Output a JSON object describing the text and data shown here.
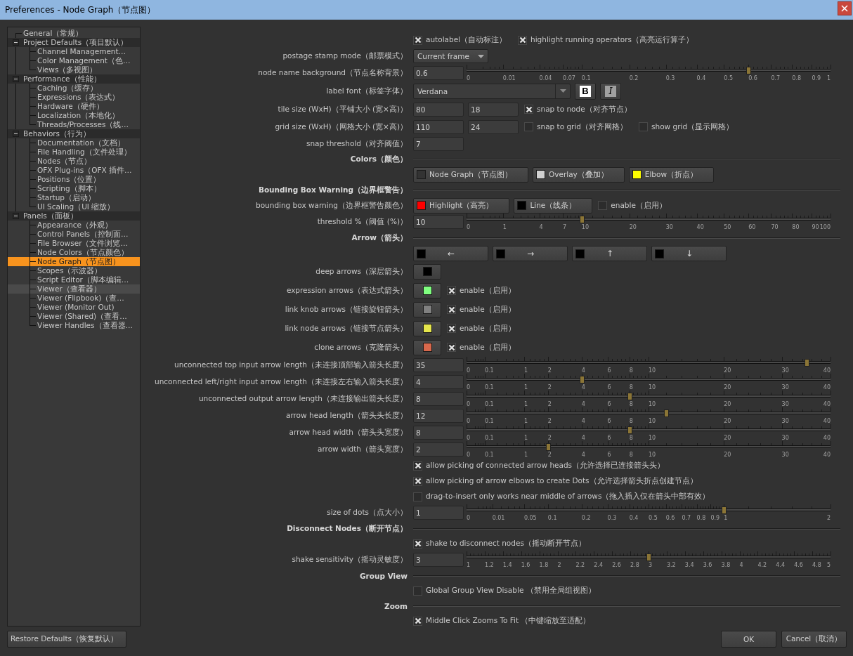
{
  "window": {
    "title": "Preferences - Node Graph（节点图）"
  },
  "sidebar": {
    "items": [
      {
        "label": "General（常规）",
        "selected": false,
        "hovered": false
      },
      {
        "label": "Project Defaults（项目默认）",
        "expanded": true,
        "selected": false,
        "hovered": false,
        "children": [
          {
            "label": "Channel Management…",
            "selected": false,
            "hovered": false
          },
          {
            "label": "Color Management（色…",
            "selected": false,
            "hovered": false
          },
          {
            "label": "Views（多视图）",
            "selected": false,
            "hovered": false
          }
        ]
      },
      {
        "label": "Performance（性能）",
        "expanded": true,
        "selected": false,
        "hovered": false,
        "children": [
          {
            "label": "Caching（缓存）",
            "selected": false,
            "hovered": false
          },
          {
            "label": "Expressions（表达式）",
            "selected": false,
            "hovered": false
          },
          {
            "label": "Hardware（硬件）",
            "selected": false,
            "hovered": false
          },
          {
            "label": "Localization（本地化）",
            "selected": false,
            "hovered": false
          },
          {
            "label": "Threads/Processes（线…",
            "selected": false,
            "hovered": false
          }
        ]
      },
      {
        "label": "Behaviors（行为）",
        "expanded": true,
        "selected": false,
        "hovered": false,
        "children": [
          {
            "label": "Documentation（文档）",
            "selected": false,
            "hovered": false
          },
          {
            "label": "File Handling（文件处理）",
            "selected": false,
            "hovered": false
          },
          {
            "label": "Nodes（节点）",
            "selected": false,
            "hovered": false
          },
          {
            "label": "OFX Plug-ins（OFX 插件…",
            "selected": false,
            "hovered": false
          },
          {
            "label": "Positions（位置）",
            "selected": false,
            "hovered": false
          },
          {
            "label": "Scripting（脚本）",
            "selected": false,
            "hovered": false
          },
          {
            "label": "Startup（启动）",
            "selected": false,
            "hovered": false
          },
          {
            "label": "UI Scaling（UI 缩放）",
            "selected": false,
            "hovered": false
          }
        ]
      },
      {
        "label": "Panels（面板）",
        "expanded": true,
        "selected": false,
        "hovered": false,
        "children": [
          {
            "label": "Appearance（外观）",
            "selected": false,
            "hovered": false
          },
          {
            "label": "Control Panels（控制面…",
            "selected": false,
            "hovered": false
          },
          {
            "label": "File Browser（文件浏览…",
            "selected": false,
            "hovered": false
          },
          {
            "label": "Node Colors（节点颜色）",
            "selected": false,
            "hovered": false
          },
          {
            "label": "Node Graph（节点图）",
            "selected": true,
            "hovered": false
          },
          {
            "label": "Scopes（示波器）",
            "selected": false,
            "hovered": false
          },
          {
            "label": "Script Editor（脚本编辑…",
            "selected": false,
            "hovered": false
          },
          {
            "label": "Viewer（查看器）",
            "selected": false,
            "hovered": true
          },
          {
            "label": "Viewer (Flipbook)（查…",
            "selected": false,
            "hovered": false
          },
          {
            "label": "Viewer (Monitor Out)",
            "selected": false,
            "hovered": false
          },
          {
            "label": "Viewer (Shared)（查看…",
            "selected": false,
            "hovered": false
          },
          {
            "label": "Viewer Handles（查看器…",
            "selected": false,
            "hovered": false
          }
        ]
      }
    ]
  },
  "rows": [
    {
      "kind": "checks",
      "checks": [
        {
          "label": "autolabel（自动标注）",
          "checked": true
        },
        {
          "label": "highlight running operators（高亮运行算子）",
          "checked": true
        }
      ]
    },
    {
      "kind": "dropdown",
      "label": "postage stamp mode（邮票模式）",
      "value": "Current frame"
    },
    {
      "kind": "slider",
      "label": "node name background（节点名称背景）",
      "value": "0.6",
      "level": 0.775,
      "ticks": [
        "0",
        "0.01",
        "0.04",
        "0.07",
        "0.1",
        "0.2",
        "0.3",
        "0.4",
        "0.5",
        "0.6",
        "0.7",
        "0.8",
        "0.9",
        "1"
      ]
    },
    {
      "kind": "font",
      "label": "label font（标签字体）",
      "value": "Verdana",
      "bold_label": "B",
      "italic_label": "I"
    },
    {
      "kind": "pair",
      "label": "tile size (WxH)（平铺大小 (宽×高)）",
      "values": [
        "80",
        "18"
      ],
      "checks": [
        {
          "label": "snap to node（对齐节点）",
          "checked": true
        }
      ]
    },
    {
      "kind": "pair",
      "label": "grid size (WxH)（网格大小 (宽×高)）",
      "values": [
        "110",
        "24"
      ],
      "checks": [
        {
          "label": "snap to grid（对齐网格）",
          "checked": false
        },
        {
          "label": "show grid（显示网格）",
          "checked": false
        }
      ]
    },
    {
      "kind": "input",
      "label": "snap threshold（对齐阈值）",
      "value": "7"
    },
    {
      "kind": "section",
      "label": "Colors（颜色）"
    },
    {
      "kind": "colors",
      "buttons": [
        {
          "label": "Node Graph（节点图）",
          "color": "#333333"
        },
        {
          "label": "Overlay（叠加）",
          "color": "#d0d0d0"
        },
        {
          "label": "Elbow（折点）",
          "color": "#ffff00"
        }
      ]
    },
    {
      "kind": "section",
      "label": "Bounding Box Warning（边界框警告）"
    },
    {
      "kind": "colors",
      "label": "bounding box warning（边界框警告颜色）",
      "buttons": [
        {
          "label": "Highlight（高亮）",
          "color": "#ff0000"
        },
        {
          "label": "Line（线条）",
          "color": "#000000"
        }
      ],
      "checks": [
        {
          "label": "enable（启用）",
          "checked": false
        }
      ]
    },
    {
      "kind": "slider",
      "label": "threshold %（阈值 (%)）",
      "value": "10",
      "level": 0.316,
      "ticks": [
        "0",
        "1",
        "4",
        "7",
        "10",
        "20",
        "30",
        "40",
        "50",
        "60",
        "70",
        "80",
        "90",
        "100"
      ]
    },
    {
      "kind": "section",
      "label": "Arrow（箭头）"
    },
    {
      "kind": "arrows",
      "buttons": [
        {
          "label": "←",
          "color": "#000000"
        },
        {
          "label": "→",
          "color": "#000000"
        },
        {
          "label": "↑",
          "color": "#000000"
        },
        {
          "label": "↓",
          "color": "#000000"
        }
      ]
    },
    {
      "kind": "swatch",
      "label": "deep arrows（深层箭头）",
      "color": "#000000"
    },
    {
      "kind": "swatch",
      "label": "expression arrows（表达式箭头）",
      "color": "#80ff80",
      "checks": [
        {
          "label": "enable（启用）",
          "checked": true
        }
      ]
    },
    {
      "kind": "swatch",
      "label": "link knob arrows（链接旋钮箭头）",
      "color": "#808080",
      "checks": [
        {
          "label": "enable（启用）",
          "checked": true
        }
      ]
    },
    {
      "kind": "swatch",
      "label": "link node arrows（链接节点箭头）",
      "color": "#e6e64c",
      "checks": [
        {
          "label": "enable（启用）",
          "checked": true
        }
      ]
    },
    {
      "kind": "swatch",
      "label": "clone arrows（克隆箭头）",
      "color": "#d8684c",
      "checks": [
        {
          "label": "enable（启用）",
          "checked": true
        }
      ]
    },
    {
      "kind": "slider",
      "label": "unconnected top input arrow length（未连接顶部输入箭头长度）",
      "value": "35",
      "level": 0.935,
      "ticks": [
        "0",
        "0.1",
        "1",
        "2",
        "4",
        "6",
        "8",
        "10",
        "20",
        "30",
        "40"
      ]
    },
    {
      "kind": "slider",
      "label": "unconnected left/right input arrow length（未连接左右输入箭头长度）",
      "value": "4",
      "level": 0.316,
      "ticks": [
        "0",
        "0.1",
        "1",
        "2",
        "4",
        "6",
        "8",
        "10",
        "20",
        "30",
        "40"
      ]
    },
    {
      "kind": "slider",
      "label": "unconnected output arrow length（未连接输出箭头长度）",
      "value": "8",
      "level": 0.447,
      "ticks": [
        "0",
        "0.1",
        "1",
        "2",
        "4",
        "6",
        "8",
        "10",
        "20",
        "30",
        "40"
      ]
    },
    {
      "kind": "slider",
      "label": "arrow head length（箭头头长度）",
      "value": "12",
      "level": 0.548,
      "ticks": [
        "0",
        "0.1",
        "1",
        "2",
        "4",
        "6",
        "8",
        "10",
        "20",
        "30",
        "40"
      ]
    },
    {
      "kind": "slider",
      "label": "arrow head width（箭头头宽度）",
      "value": "8",
      "level": 0.447,
      "ticks": [
        "0",
        "0.1",
        "1",
        "2",
        "4",
        "6",
        "8",
        "10",
        "20",
        "30",
        "40"
      ]
    },
    {
      "kind": "slider",
      "label": "arrow width（箭头宽度）",
      "value": "2",
      "level": 0.224,
      "ticks": [
        "0",
        "0.1",
        "1",
        "2",
        "4",
        "6",
        "8",
        "10",
        "20",
        "30",
        "40"
      ]
    },
    {
      "kind": "checks",
      "checks": [
        {
          "label": "allow picking of connected arrow heads（允许选择已连接箭头头）",
          "checked": true
        }
      ]
    },
    {
      "kind": "checks",
      "checks": [
        {
          "label": "allow picking of arrow elbows to create Dots（允许选择箭头折点创建节点）",
          "checked": true
        }
      ]
    },
    {
      "kind": "checks",
      "checks": [
        {
          "label": "drag-to-insert only works near middle of arrows（拖入插入仅在箭头中部有效）",
          "checked": false
        }
      ]
    },
    {
      "kind": "slider",
      "label": "size of dots（点大小）",
      "value": "1",
      "level": 0.707,
      "ticks": [
        "0",
        "0.01",
        "0.05",
        "0.1",
        "0.2",
        "0.3",
        "0.4",
        "0.5",
        "0.6",
        "0.7",
        "0.8",
        "0.9",
        "1",
        "2"
      ]
    },
    {
      "kind": "section",
      "label": "Disconnect Nodes（断开节点）"
    },
    {
      "kind": "checks",
      "checks": [
        {
          "label": "shake to disconnect nodes（摇动断开节点）",
          "checked": true
        }
      ]
    },
    {
      "kind": "slider",
      "label": "shake sensitivity（摇动灵敏度）",
      "value": "3",
      "level": 0.5,
      "ticks": [
        "1",
        "1.2",
        "1.4",
        "1.6",
        "1.8",
        "2",
        "2.2",
        "2.4",
        "2.6",
        "2.8",
        "3",
        "3.2",
        "3.4",
        "3.6",
        "3.8",
        "4",
        "4.2",
        "4.4",
        "4.6",
        "4.8",
        "5"
      ]
    },
    {
      "kind": "section",
      "label": "Group View"
    },
    {
      "kind": "checks",
      "checks": [
        {
          "label": "Global Group View Disable （禁用全局组视图）",
          "checked": false
        }
      ]
    },
    {
      "kind": "section",
      "label": "Zoom"
    },
    {
      "kind": "checks",
      "checks": [
        {
          "label": "Middle Click Zooms To Fit （中键缩放至适配）",
          "checked": true
        }
      ]
    }
  ],
  "buttons": [
    {
      "label": "Restore Defaults（恢复默认）",
      "kind": "reset"
    },
    {
      "label": "OK",
      "kind": "confirm"
    },
    {
      "label": "Cancel（取消）",
      "kind": "cancel"
    }
  ]
}
